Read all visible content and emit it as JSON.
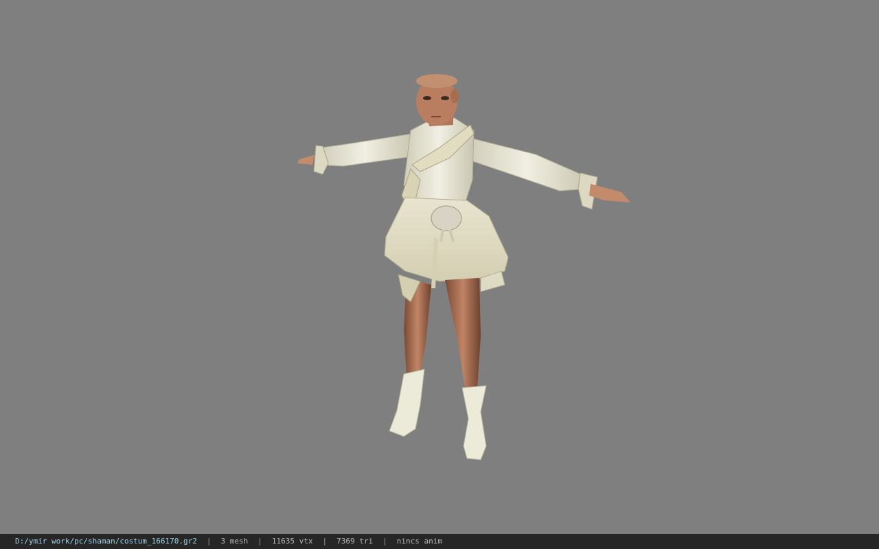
{
  "viewport": {
    "background_color": "#7f7f7f",
    "model_icon": "character-model"
  },
  "statusbar": {
    "file_path": "D:/ymir work/pc/shaman/costum_166170.gr2",
    "separator": "|",
    "mesh_count": "3 mesh",
    "vertex_count": "11635 vtx",
    "triangle_count": "7369 tri",
    "anim_status": "nincs anim"
  },
  "colors": {
    "statusbar_bg": "#262626",
    "path_text": "#9fd0e8",
    "status_text": "#b8b8b8"
  }
}
